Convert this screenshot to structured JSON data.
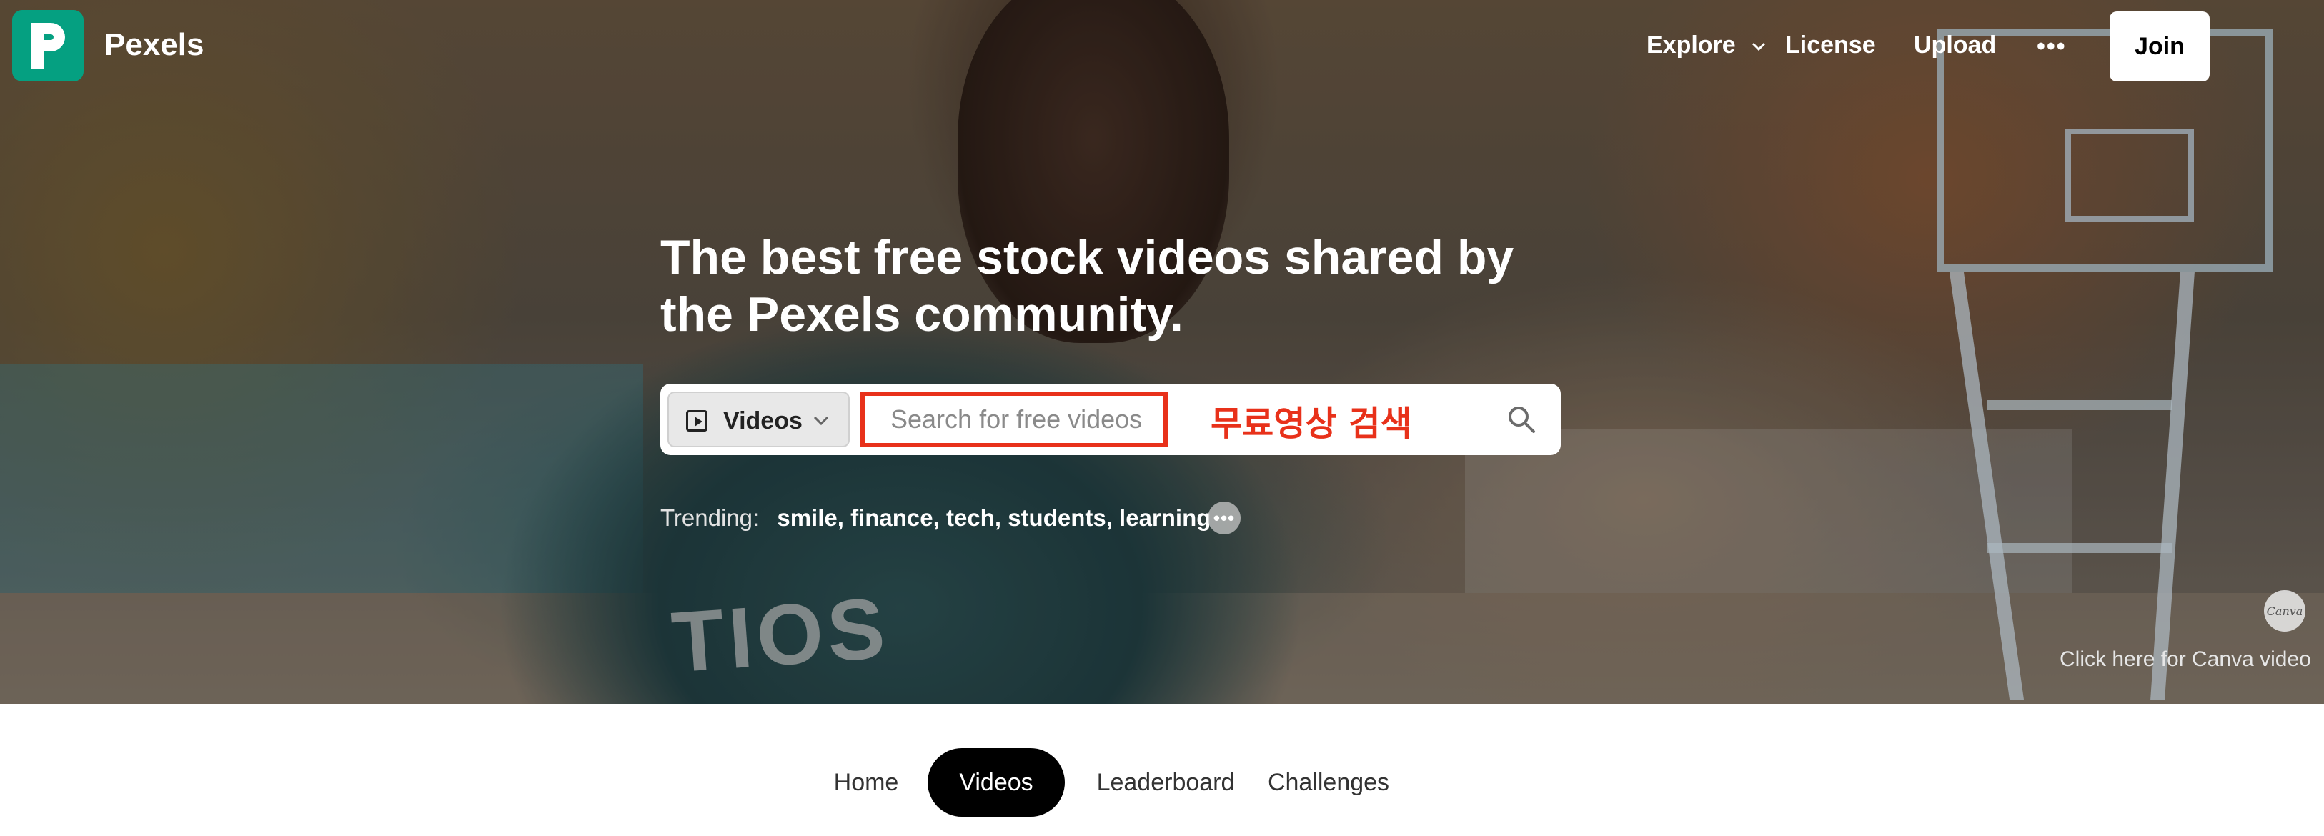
{
  "brand": {
    "name": "Pexels",
    "logo_letter": "P"
  },
  "nav": {
    "explore": "Explore",
    "license": "License",
    "upload": "Upload",
    "more": "•••",
    "join": "Join"
  },
  "hero": {
    "jersey_text": "TIOS",
    "headline": "The best free stock videos shared by the Pexels community.",
    "search": {
      "type_label": "Videos",
      "placeholder": "Search for free videos",
      "value": "",
      "annotation": "무료영상 검색",
      "annotation_color": "#e8311a"
    },
    "trending": {
      "label": "Trending:",
      "items": [
        "smile",
        "finance",
        "tech",
        "students",
        "learning"
      ],
      "more": "•••"
    },
    "canva_badge": "Canva",
    "canva_link": "Click here for Canva video"
  },
  "tabs": [
    {
      "label": "Home",
      "active": false
    },
    {
      "label": "Videos",
      "active": true
    },
    {
      "label": "Leaderboard",
      "active": false
    },
    {
      "label": "Challenges",
      "active": false
    }
  ],
  "colors": {
    "brand": "#05a081",
    "accent_red": "#e8311a"
  }
}
